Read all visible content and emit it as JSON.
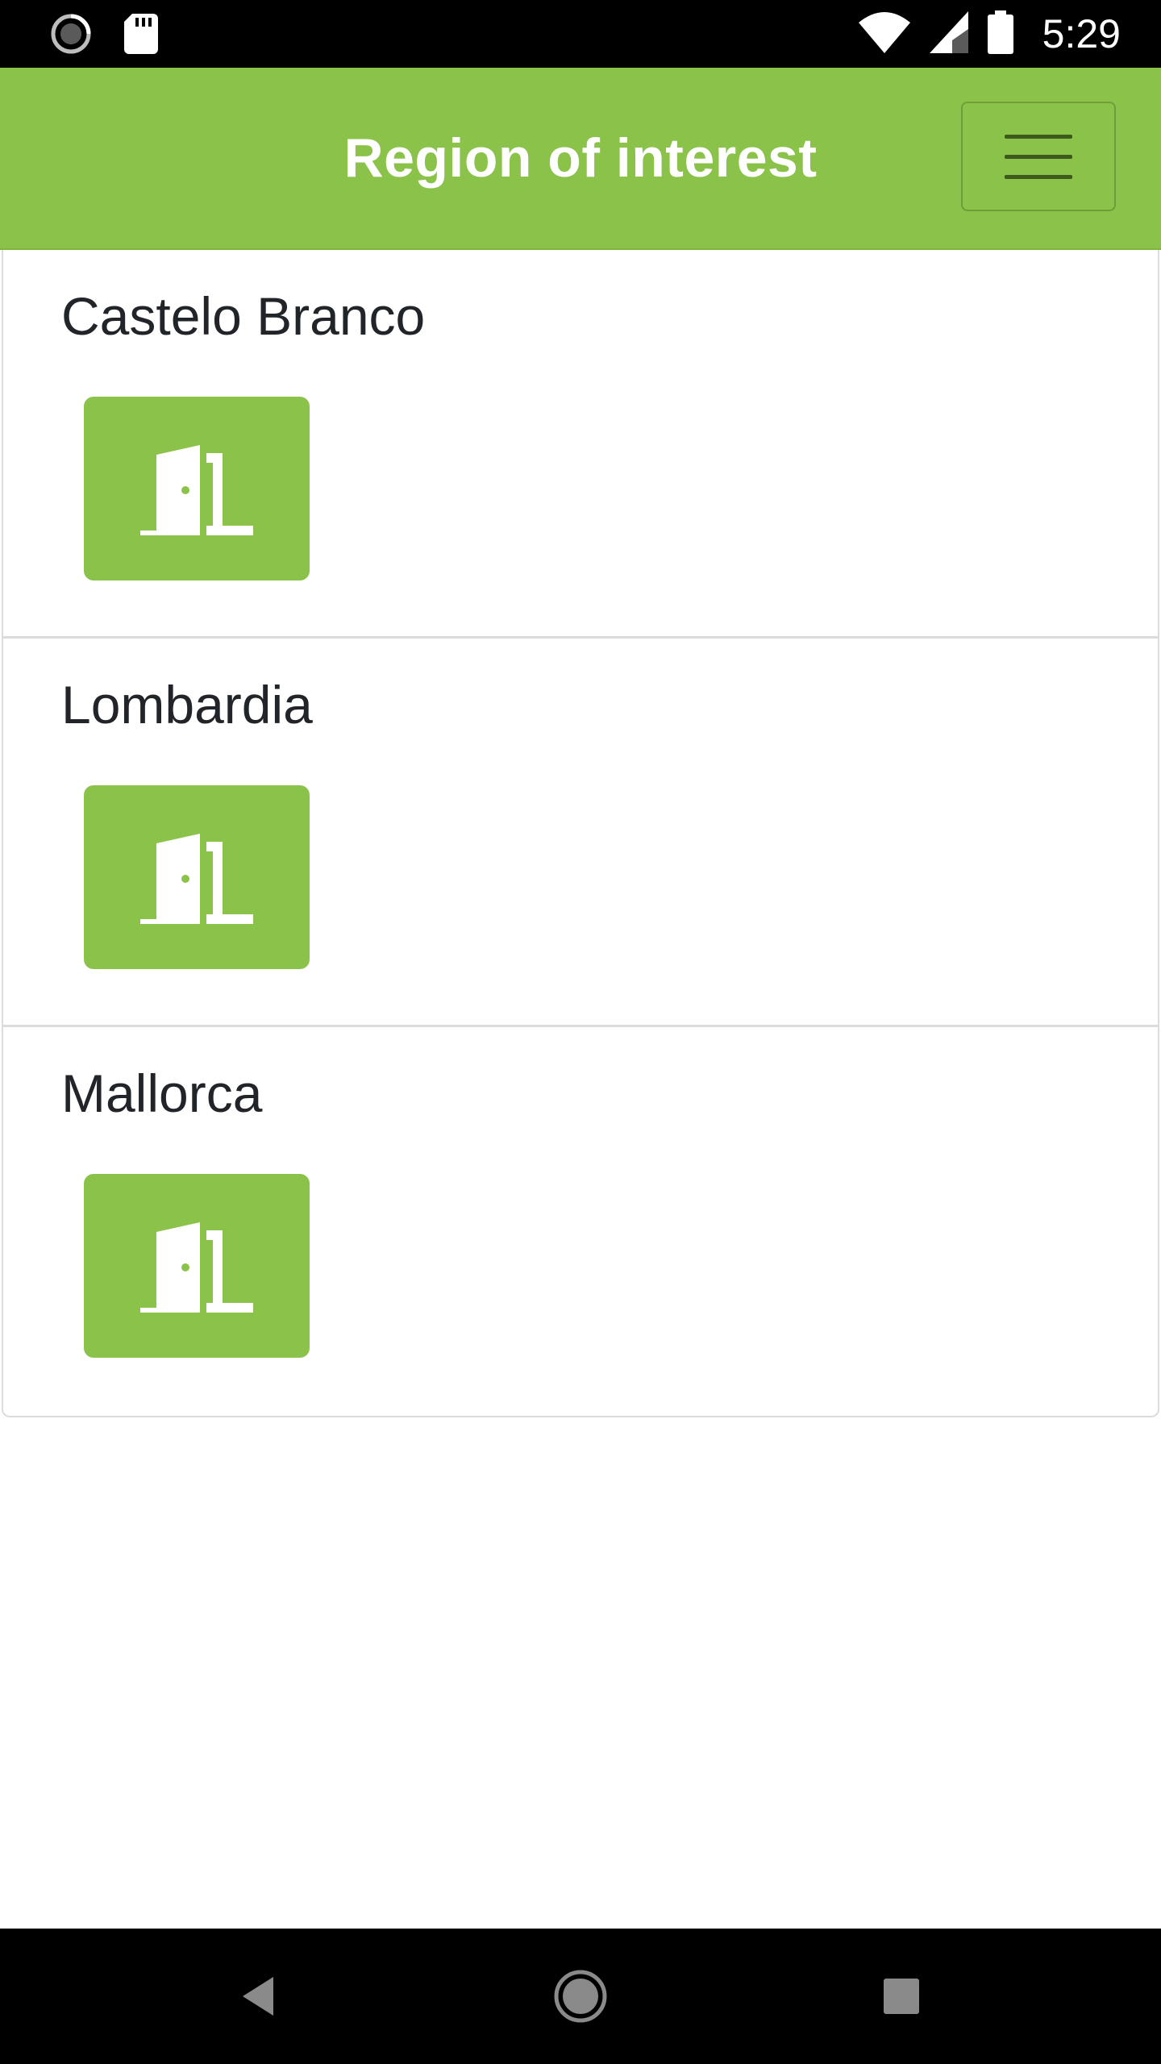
{
  "status_bar": {
    "time": "5:29",
    "icons": [
      "sync-icon",
      "sd-card-icon",
      "wifi-icon",
      "signal-icon",
      "battery-icon"
    ]
  },
  "app_bar": {
    "title": "Region of interest",
    "menu_icon": "hamburger-menu-icon",
    "background_color": "#8bc34a"
  },
  "regions": [
    {
      "name": "Castelo Branco",
      "action_icon": "door-enter-icon"
    },
    {
      "name": "Lombardia",
      "action_icon": "door-enter-icon"
    },
    {
      "name": "Mallorca",
      "action_icon": "door-enter-icon"
    }
  ],
  "nav_bar": {
    "buttons": [
      "back-icon",
      "home-icon",
      "recents-icon"
    ]
  },
  "colors": {
    "accent": "#8bc34a",
    "text": "#212529",
    "divider": "#dcdcdc"
  }
}
